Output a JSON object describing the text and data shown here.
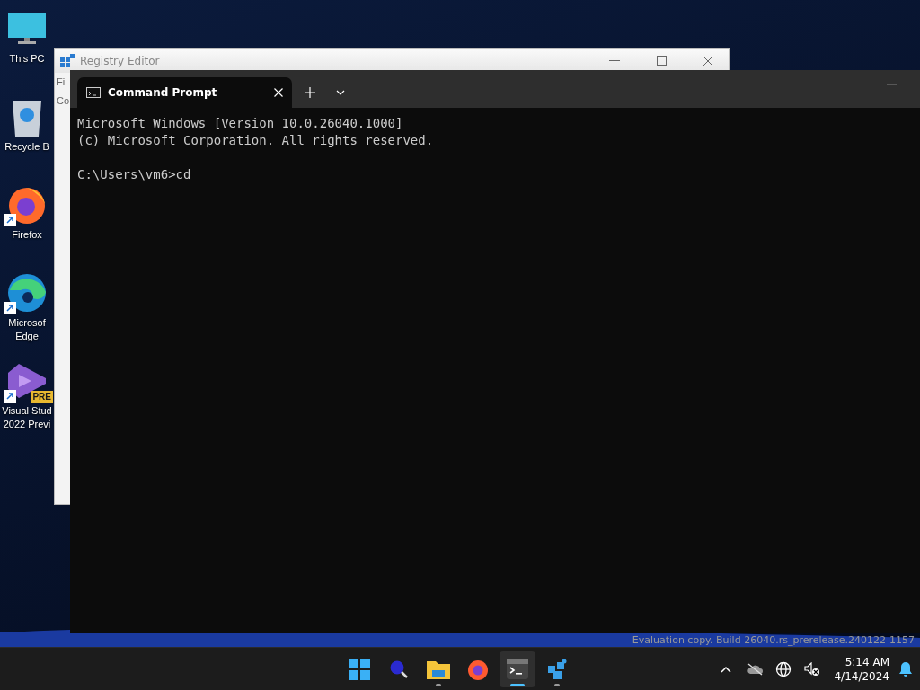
{
  "desktop_icons": [
    {
      "kind": "pc",
      "lines": [
        "This PC"
      ],
      "shortcut": false
    },
    {
      "kind": "recycle",
      "lines": [
        "Recycle B"
      ],
      "shortcut": false
    },
    {
      "kind": "firefox",
      "lines": [
        "Firefox"
      ],
      "shortcut": true
    },
    {
      "kind": "edge",
      "lines": [
        "Microsof",
        "Edge"
      ],
      "shortcut": true
    },
    {
      "kind": "vs",
      "lines": [
        "Visual Stud",
        "2022 Previ"
      ],
      "shortcut": true,
      "badge": "PRE"
    }
  ],
  "registry_editor": {
    "title": "Registry Editor",
    "menu": [
      "Fi",
      "Co"
    ]
  },
  "terminal": {
    "tabs": [
      {
        "label": "Command Prompt",
        "selected": true
      }
    ],
    "lines": [
      "Microsoft Windows [Version 10.0.26040.1000]",
      "(c) Microsoft Corporation. All rights reserved."
    ],
    "prompt": "C:\\Users\\vm6>cd "
  },
  "watermark_text": "Evaluation copy. Build 26040.rs_prerelease.240122-1157",
  "taskbar": {
    "apps": [
      {
        "kind": "start",
        "running": false,
        "selected": false
      },
      {
        "kind": "search",
        "running": false,
        "selected": false
      },
      {
        "kind": "explorer",
        "running": true,
        "selected": false
      },
      {
        "kind": "firefox",
        "running": false,
        "selected": false
      },
      {
        "kind": "terminal",
        "running": true,
        "selected": true
      },
      {
        "kind": "cubes",
        "running": true,
        "selected": false
      }
    ],
    "tray": [
      {
        "kind": "chevron"
      },
      {
        "kind": "cloud"
      },
      {
        "kind": "globe"
      },
      {
        "kind": "volume"
      }
    ],
    "time": "5:14 AM",
    "date": "4/14/2024"
  }
}
